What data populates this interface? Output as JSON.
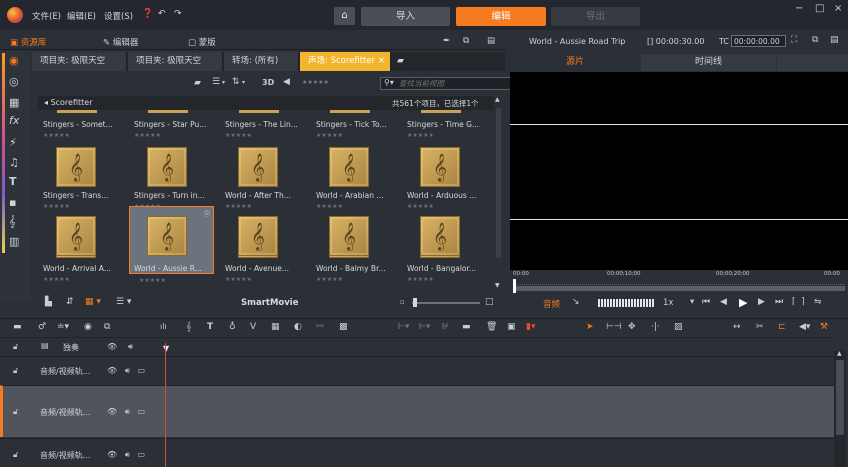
{
  "titlebar": {
    "menus": [
      "文件(E)",
      "编辑(E)",
      "设置(S)"
    ],
    "modes": {
      "import": "导入",
      "edit": "编辑",
      "export": "导出"
    },
    "window_controls": [
      "−",
      "□",
      "×"
    ]
  },
  "library": {
    "tabs": {
      "library": "资源库",
      "editor": "编辑器",
      "mask": "蒙版"
    },
    "content_tabs": [
      {
        "label": "项目夹: 极限天空"
      },
      {
        "label": "项目夹: 极限天空"
      },
      {
        "label": "转场: (所有)"
      },
      {
        "label": "声场: Scorefitter"
      }
    ],
    "toolbar": {
      "view_3d": "3D",
      "search_placeholder": "查找当前视图"
    },
    "folder": "Scorefitter",
    "count_text": "共561个项目，已选择1个",
    "items": [
      {
        "name": "Stingers - Somet...",
        "stars": "★★★★★"
      },
      {
        "name": "Stingers - Star Pu...",
        "stars": "★★★★★"
      },
      {
        "name": "Stingers - The Lin...",
        "stars": "★★★★★"
      },
      {
        "name": "Stingers - Tick To...",
        "stars": "★★★★★"
      },
      {
        "name": "Stingers - Time G...",
        "stars": "★★★★★"
      },
      {
        "name": "Stingers - Trans...",
        "stars": "★★★★★"
      },
      {
        "name": "Stingers - Turn in...",
        "stars": "★★★★★"
      },
      {
        "name": "World - After Th...",
        "stars": "★★★★★"
      },
      {
        "name": "World - Arabian ...",
        "stars": "★★★★★"
      },
      {
        "name": "World - Arduous ...",
        "stars": "★★★★★"
      },
      {
        "name": "World - Arrival A...",
        "stars": "★★★★★"
      },
      {
        "name": "World - Aussie R...",
        "stars": "★★★★★",
        "selected": true
      },
      {
        "name": "World - Avenue...",
        "stars": "★★★★★"
      },
      {
        "name": "World - Balmy Br...",
        "stars": "★★★★★"
      },
      {
        "name": "World - Bangalor...",
        "stars": "★★★★★"
      }
    ],
    "bottom_bar": {
      "smartmovie": "SmartMovie"
    }
  },
  "player": {
    "title": "World - Aussie Road Trip",
    "duration": "[] 00:00:30.00",
    "tc_label": "TC",
    "timecode": "00:00:00.00",
    "tabs": {
      "source": "源片",
      "timeline": "时间线"
    },
    "ruler_labels": [
      "00:00",
      "00;00;10;00",
      "00;00;20;00",
      "00:00"
    ],
    "audio_label": "音频",
    "speed": "1x"
  },
  "timeline": {
    "tracks": [
      {
        "label": "独奏"
      },
      {
        "label": "音频/视频轨..."
      },
      {
        "label": "音频/视频轨..."
      },
      {
        "label": "音频/视频轨..."
      }
    ]
  },
  "colors": {
    "accent": "#f47b20",
    "active_tab": "#f2b52b",
    "background": "#2b2f36"
  }
}
